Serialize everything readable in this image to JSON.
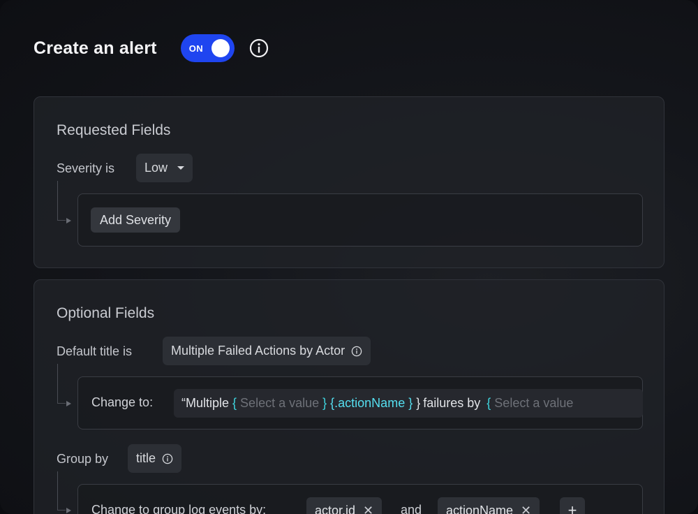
{
  "header": {
    "title": "Create an alert",
    "toggle_label": "ON",
    "toggle_state": "on"
  },
  "colors": {
    "accent": "#1f45f0",
    "token": "#55dff0",
    "placeholder": "#6e7178"
  },
  "requested": {
    "title": "Requested Fields",
    "severity_label": "Severity is",
    "severity_value": "Low",
    "add_severity_label": "Add Severity"
  },
  "optional": {
    "title": "Optional Fields",
    "default_title_label": "Default title is",
    "default_title_value": "Multiple Failed Actions by Actor",
    "change_to_label": "Change to:",
    "title_template": {
      "prefix": "“Multiple",
      "open1": "{",
      "placeholder1": "Select a value",
      "close1": "}",
      "token": "{.actionName",
      "close_token": "}",
      "close2": "}",
      "middle": "failures by",
      "open2": "{",
      "placeholder2": "Select a value"
    },
    "group_by_label": "Group by",
    "group_by_value": "title",
    "group_change_label": "Change to group log events by:",
    "group_tags": [
      "actor.id",
      "actionName"
    ],
    "and_label": "and",
    "add_tag_label": "+"
  }
}
